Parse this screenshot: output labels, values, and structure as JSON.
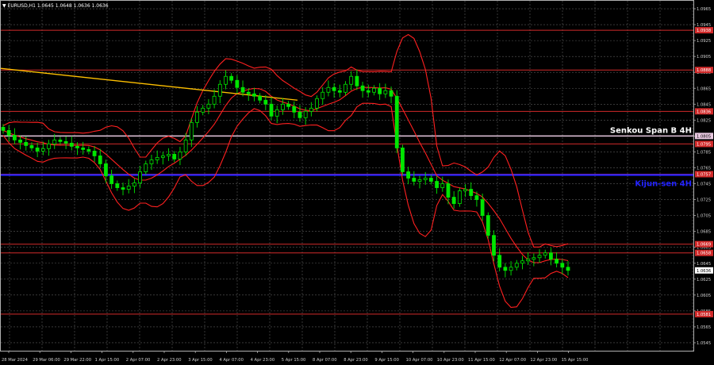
{
  "header": {
    "symbol_line": "▼ EURUSD,H1  1.0645 1.0648 1.0636 1.0636"
  },
  "chart_data": {
    "type": "candlestick",
    "symbol": "EURUSD",
    "timeframe": "H1",
    "ohlc_last": {
      "open": 1.0645,
      "high": 1.0648,
      "low": 1.0636,
      "close": 1.0636
    },
    "ylim": [
      1.0535,
      1.0975
    ],
    "y_ticks": [
      "1.0965",
      "1.0945",
      "1.0925",
      "1.0905",
      "1.0885",
      "1.0865",
      "1.0845",
      "1.0825",
      "1.0805",
      "1.0785",
      "1.0765",
      "1.0745",
      "1.0725",
      "1.0705",
      "1.0685",
      "1.0665",
      "1.0645",
      "1.0625",
      "1.0605",
      "1.0585",
      "1.0565",
      "1.0545"
    ],
    "x_ticks": [
      "28 Mar 2024",
      "29 Mar 06:00",
      "29 Mar 22:00",
      "1 Apr 15:00",
      "2 Apr 07:00",
      "2 Apr 23:00",
      "3 Apr 15:00",
      "4 Apr 07:00",
      "4 Apr 23:00",
      "5 Apr 15:00",
      "8 Apr 07:00",
      "8 Apr 23:00",
      "9 Apr 15:00",
      "10 Apr 07:00",
      "10 Apr 23:00",
      "11 Apr 15:00",
      "12 Apr 07:00",
      "12 Apr 23:00",
      "15 Apr 15:00"
    ],
    "levels": [
      {
        "price": 1.0938,
        "tag": "1.0938",
        "color": "#d12a2a"
      },
      {
        "price": 1.0888,
        "tag": "1.0888",
        "color": "#d12a2a"
      },
      {
        "price": 1.0836,
        "tag": "1.0836",
        "color": "#d12a2a"
      },
      {
        "price": 1.0795,
        "tag": "1.0795",
        "color": "#d12a2a"
      },
      {
        "price": 1.0757,
        "tag": "1.0757",
        "color": "#d12a2a"
      },
      {
        "price": 1.0669,
        "tag": "1.0669",
        "color": "#d12a2a"
      },
      {
        "price": 1.0658,
        "tag": "1.0658",
        "color": "#d12a2a"
      },
      {
        "price": 1.0581,
        "tag": "1.0581",
        "color": "#d12a2a"
      }
    ],
    "senkou_span_b": {
      "label": "Senkou Span B 4H",
      "price": 1.0805,
      "tag": "1.0805",
      "color": "#e8c8e0"
    },
    "kijun_sen": {
      "label": "Kijun-sen 4H",
      "price": 1.0756,
      "color": "#2323ff"
    },
    "current_price": {
      "tag": "1.0636",
      "price": 1.0636
    },
    "trendline": {
      "color": "#ffc000",
      "start": {
        "price": 1.089
      },
      "end": {
        "price": 1.085
      }
    },
    "close_series": [
      1.0812,
      1.0806,
      1.08,
      1.0797,
      1.0793,
      1.079,
      1.0786,
      1.0789,
      1.0795,
      1.08,
      1.0798,
      1.0796,
      1.0792,
      1.079,
      1.0788,
      1.0786,
      1.078,
      1.077,
      1.0755,
      1.0745,
      1.074,
      1.0738,
      1.0742,
      1.0746,
      1.076,
      1.077,
      1.0775,
      1.0778,
      1.078,
      1.0782,
      1.0776,
      1.0785,
      1.08,
      1.0822,
      1.0835,
      1.084,
      1.0845,
      1.0855,
      1.087,
      1.088,
      1.0875,
      1.0866,
      1.086,
      1.0858,
      1.0855,
      1.085,
      1.0845,
      1.083,
      1.0838,
      1.0845,
      1.0842,
      1.0835,
      1.0828,
      1.0836,
      1.084,
      1.0852,
      1.086,
      1.0866,
      1.0862,
      1.086,
      1.087,
      1.088,
      1.0868,
      1.0862,
      1.086,
      1.0865,
      1.0858,
      1.0862,
      1.0855,
      1.079,
      1.076,
      1.0752,
      1.0748,
      1.075,
      1.0752,
      1.0748,
      1.074,
      1.0745,
      1.0728,
      1.072,
      1.0736,
      1.0738,
      1.073,
      1.0725,
      1.0705,
      1.068,
      1.0655,
      1.064,
      1.0636,
      1.064,
      1.0645,
      1.0648,
      1.065,
      1.0652,
      1.0655,
      1.0658,
      1.065,
      1.0645,
      1.064,
      1.0636
    ],
    "annotations": [
      "Senkou Span B 4H",
      "Kijun-sen 4H"
    ],
    "grid": true
  }
}
